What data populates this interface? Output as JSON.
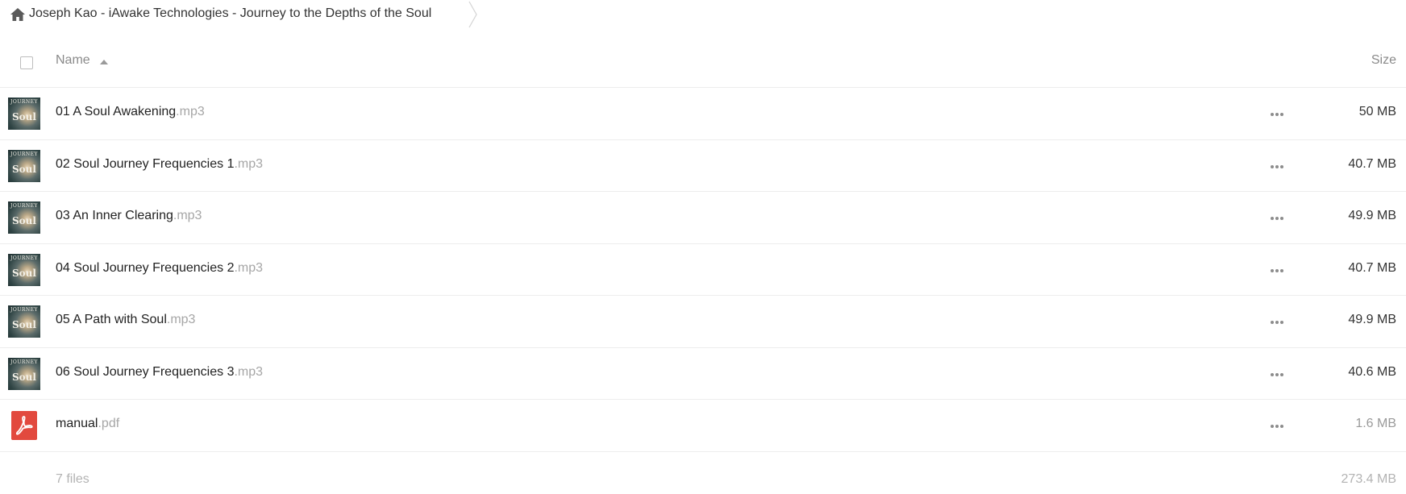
{
  "breadcrumb": {
    "path": "Joseph Kao - iAwake Technologies - Journey to the Depths of the Soul"
  },
  "header": {
    "name_label": "Name",
    "size_label": "Size"
  },
  "files": [
    {
      "base": "01 A Soul Awakening",
      "ext": ".mp3",
      "size": "50 MB",
      "icon": "album-art-thumbnail"
    },
    {
      "base": "02 Soul Journey Frequencies 1",
      "ext": ".mp3",
      "size": "40.7 MB",
      "icon": "album-art-thumbnail"
    },
    {
      "base": "03 An Inner Clearing",
      "ext": ".mp3",
      "size": "49.9 MB",
      "icon": "album-art-thumbnail"
    },
    {
      "base": "04 Soul Journey Frequencies 2",
      "ext": ".mp3",
      "size": "40.7 MB",
      "icon": "album-art-thumbnail"
    },
    {
      "base": "05 A Path with Soul",
      "ext": ".mp3",
      "size": "49.9 MB",
      "icon": "album-art-thumbnail"
    },
    {
      "base": "06 Soul Journey Frequencies 3",
      "ext": ".mp3",
      "size": "40.6 MB",
      "icon": "album-art-thumbnail"
    },
    {
      "base": "manual",
      "ext": ".pdf",
      "size": "1.6 MB",
      "icon": "pdf-icon"
    }
  ],
  "thumbnail_text": {
    "top": "JOURNEY",
    "main": "Soul"
  },
  "summary": {
    "count": "7 files",
    "total_size": "273.4 MB"
  },
  "colors": {
    "pdf_red": "#e2493e",
    "text_primary": "#222222",
    "text_muted": "#a6a6a6"
  }
}
